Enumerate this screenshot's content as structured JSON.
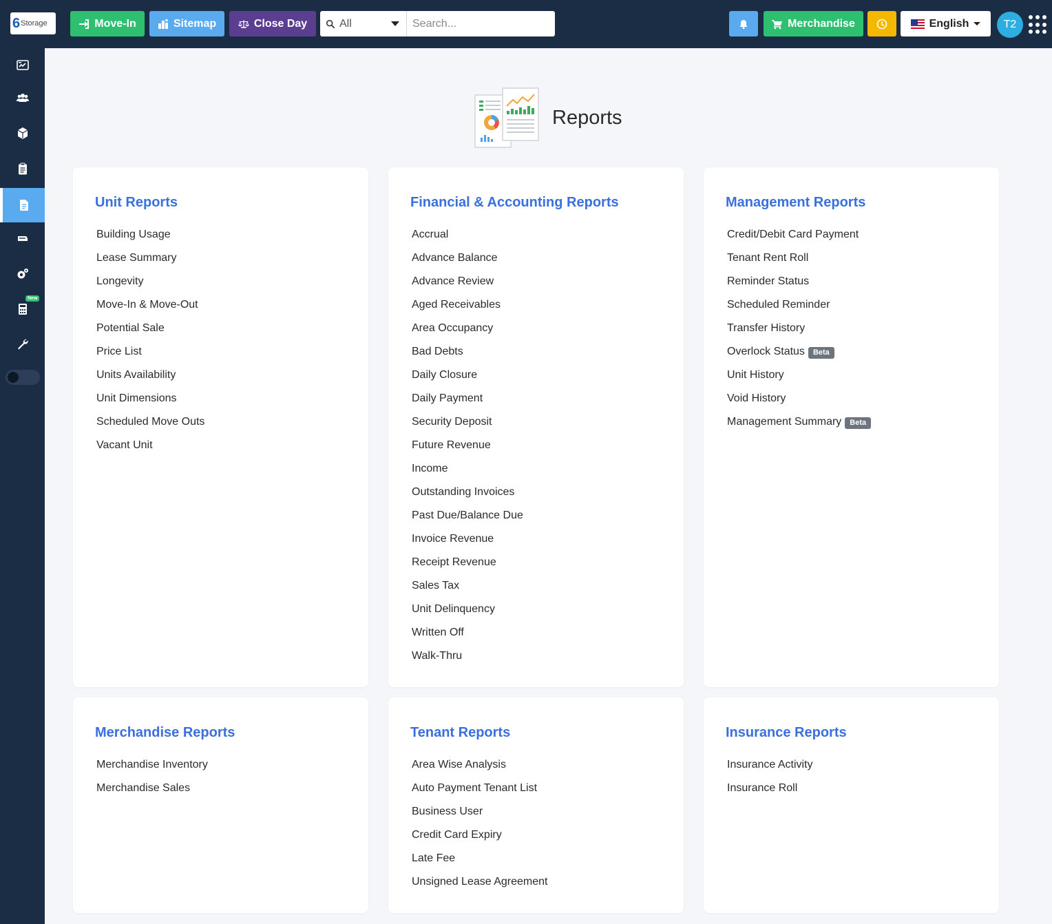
{
  "topbar": {
    "logo_digit": "6",
    "logo_text": "Storage",
    "movein_label": "Move-In",
    "sitemap_label": "Sitemap",
    "closeday_label": "Close Day",
    "search_scope": "All",
    "search_placeholder": "Search...",
    "merchandise_label": "Merchandise",
    "language_label": "English",
    "avatar_initials": "T2"
  },
  "sidebar": {
    "items": [
      {
        "name": "dashboard-icon"
      },
      {
        "name": "tenants-icon"
      },
      {
        "name": "units-icon"
      },
      {
        "name": "clipboard-icon"
      },
      {
        "name": "reports-icon",
        "active": true
      },
      {
        "name": "payments-icon"
      },
      {
        "name": "settings-icon"
      },
      {
        "name": "calculator-icon",
        "badge": "New"
      },
      {
        "name": "tools-icon"
      }
    ]
  },
  "page": {
    "title": "Reports"
  },
  "cards": {
    "unit": {
      "title": "Unit Reports",
      "items": [
        "Building Usage",
        "Lease Summary",
        "Longevity",
        "Move-In & Move-Out",
        "Potential Sale",
        "Price List",
        "Units Availability",
        "Unit Dimensions",
        "Scheduled Move Outs",
        "Vacant Unit"
      ]
    },
    "financial": {
      "title": "Financial & Accounting Reports",
      "items": [
        "Accrual",
        "Advance Balance",
        "Advance Review",
        "Aged Receivables",
        "Area Occupancy",
        "Bad Debts",
        "Daily Closure",
        "Daily Payment",
        "Security Deposit",
        "Future Revenue",
        "Income",
        "Outstanding Invoices",
        "Past Due/Balance Due",
        "Invoice Revenue",
        "Receipt Revenue",
        "Sales Tax",
        "Unit Delinquency",
        "Written Off",
        "Walk-Thru"
      ]
    },
    "management": {
      "title": "Management Reports",
      "items": [
        "Credit/Debit Card Payment",
        "Tenant Rent Roll",
        "Reminder Status",
        "Scheduled Reminder",
        "Transfer History",
        "Overlock Status",
        "Unit History",
        "Void History",
        "Management Summary"
      ],
      "badges": {
        "overlock": "Beta",
        "summary": "Beta"
      }
    },
    "merchandise": {
      "title": "Merchandise Reports",
      "items": [
        "Merchandise Inventory",
        "Merchandise Sales"
      ]
    },
    "tenant": {
      "title": "Tenant Reports",
      "items": [
        "Area Wise Analysis",
        "Auto Payment Tenant List",
        "Business User",
        "Credit Card Expiry",
        "Late Fee",
        "Unsigned Lease Agreement"
      ]
    },
    "insurance": {
      "title": "Insurance Reports",
      "items": [
        "Insurance Activity",
        "Insurance Roll"
      ]
    }
  },
  "colors": {
    "topbar_bg": "#1b2c45",
    "accent_blue": "#3a6fe0",
    "green": "#2fbf71",
    "light_blue": "#5aaaf0",
    "purple": "#5b3e8f",
    "yellow": "#f5b800"
  }
}
